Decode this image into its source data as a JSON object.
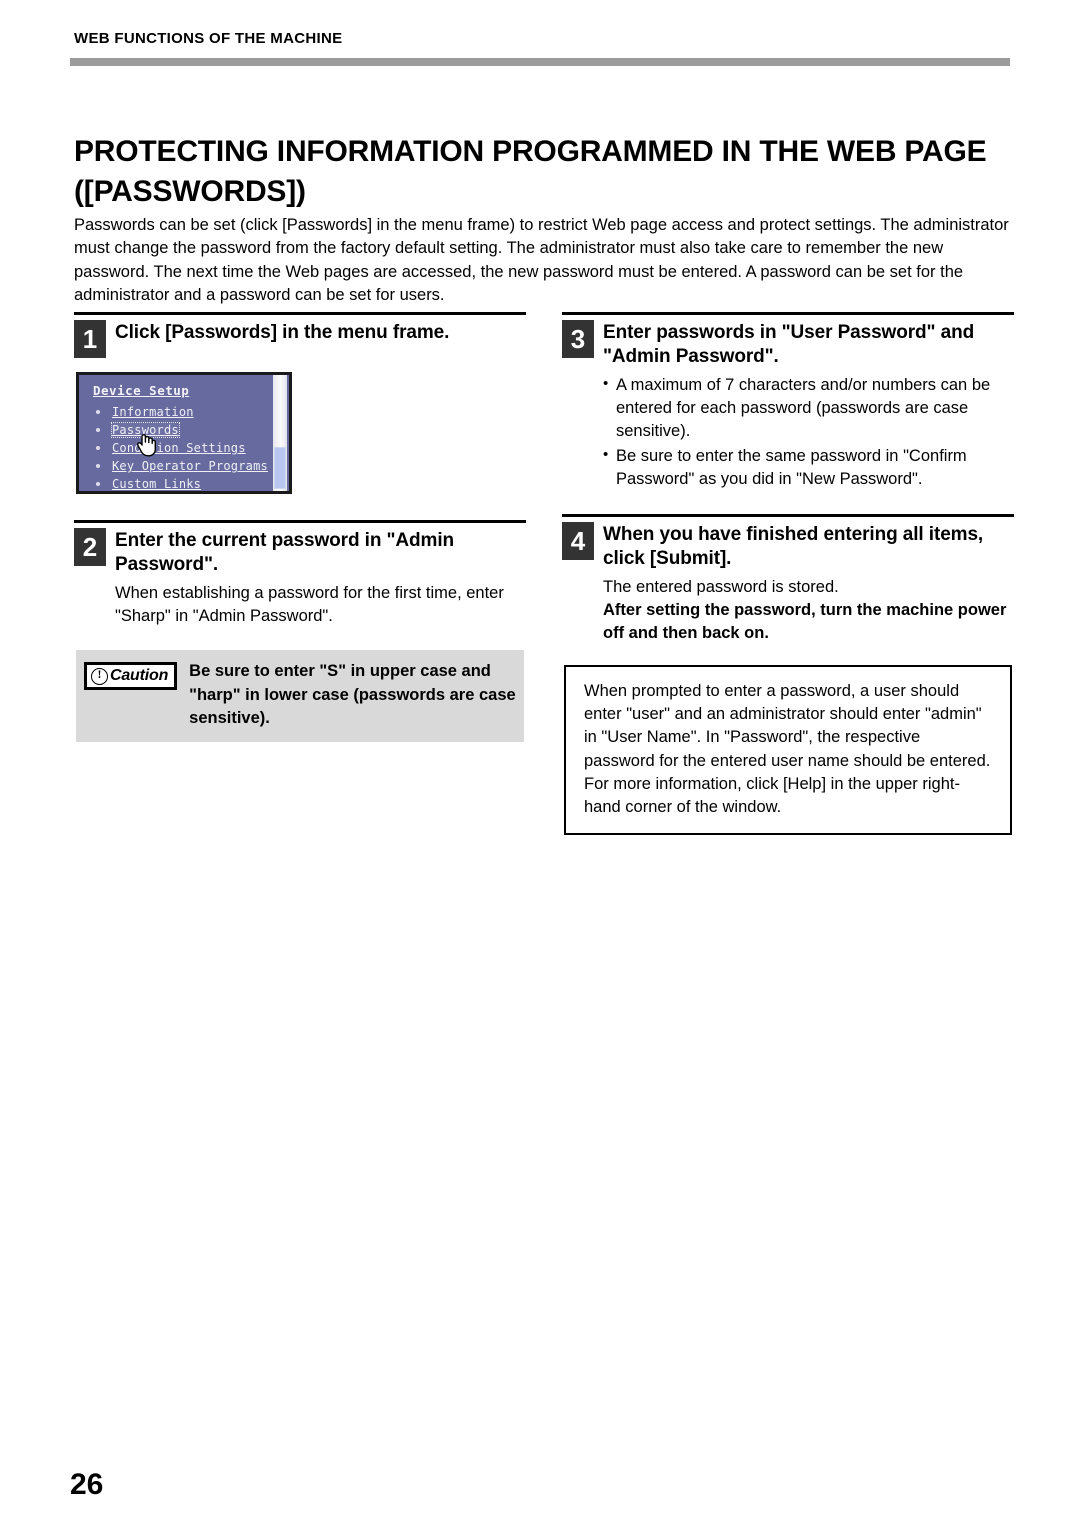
{
  "header": {
    "running_title": "WEB FUNCTIONS OF THE MACHINE"
  },
  "title": "PROTECTING INFORMATION PROGRAMMED IN THE WEB PAGE ([PASSWORDS])",
  "intro": "Passwords can be set (click [Passwords] in the menu frame) to restrict Web page access and protect settings. The administrator must change the password from the factory default setting. The administrator must also take care to remember the new password. The next time the Web pages are accessed, the new password must be entered. A password can be set for the administrator and a password can be set for users.",
  "steps": {
    "step1": {
      "number": "1",
      "title": "Click [Passwords] in the menu frame."
    },
    "step2": {
      "number": "2",
      "title": "Enter the current password in \"Admin Password\".",
      "body": "When establishing a password for the first time, enter \"Sharp\" in \"Admin Password\"."
    },
    "step3": {
      "number": "3",
      "title": "Enter passwords in \"User Password\" and \"Admin Password\".",
      "bullets": [
        "A maximum of 7 characters and/or numbers can be entered for each password (passwords are case sensitive).",
        "Be sure to enter the same password in \"Confirm Password\" as you did in \"New Password\"."
      ]
    },
    "step4": {
      "number": "4",
      "title": "When you have finished entering all items, click [Submit].",
      "body_normal": "The entered password is stored.",
      "body_bold": "After setting the password, turn the machine power off and then back on."
    }
  },
  "screenshot": {
    "panel_title": "Device Setup",
    "menu_items": [
      {
        "label": "Information",
        "selected": false
      },
      {
        "label": "Passwords",
        "selected": true
      },
      {
        "label": "Condition Settings",
        "selected": false
      },
      {
        "label": "Key Operator Programs",
        "selected": false
      },
      {
        "label": "Custom Links",
        "selected": false
      }
    ],
    "panel_bg_color": "#666a9e",
    "link_color": "#f0f0f6"
  },
  "caution": {
    "label": "Caution",
    "text": "Be sure to enter \"S\" in upper case and \"harp\" in lower case (passwords are case sensitive)."
  },
  "note": {
    "paragraph1": "When prompted to enter a password, a user should enter \"user\" and an administrator should enter \"admin\" in \"User Name\". In \"Password\", the respective password for the entered user name should be entered.",
    "paragraph2": "For more information, click [Help] in the upper right-hand corner of the window."
  },
  "page_number": "26"
}
